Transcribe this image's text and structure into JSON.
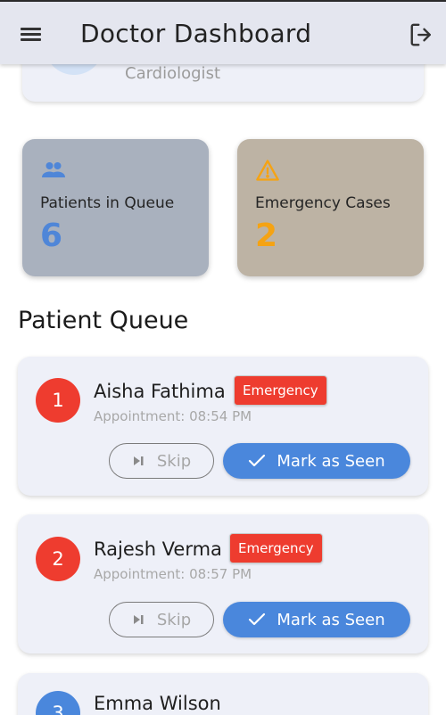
{
  "appbar": {
    "title": "Doctor Dashboard",
    "menu_icon": "menu-icon",
    "logout_icon": "logout-icon"
  },
  "profile": {
    "specialty": "Cardiologist"
  },
  "stats": {
    "queue": {
      "label": "Patients in Queue",
      "value": "6",
      "icon": "people-icon",
      "color": "#4f86d8"
    },
    "emergency": {
      "label": "Emergency Cases",
      "value": "2",
      "icon": "warning-icon",
      "color": "#f5a313"
    }
  },
  "queue": {
    "title": "Patient Queue",
    "patients": [
      {
        "number": "1",
        "name": "Aisha Fathima",
        "badge": "Emergency",
        "appointment": "Appointment: 08:54 PM",
        "skip_label": "Skip",
        "seen_label": "Mark as Seen"
      },
      {
        "number": "2",
        "name": "Rajesh Verma",
        "badge": "Emergency",
        "appointment": "Appointment: 08:57 PM",
        "skip_label": "Skip",
        "seen_label": "Mark as Seen"
      },
      {
        "number": "3",
        "name": "Emma Wilson"
      }
    ]
  },
  "colors": {
    "appbar_bg": "#e4e6ef",
    "emergency_badge": "#ee3c2f",
    "emergency_number": "#ee3c2f",
    "normal_number": "#4a87dc",
    "primary_button": "#4a87dc"
  }
}
